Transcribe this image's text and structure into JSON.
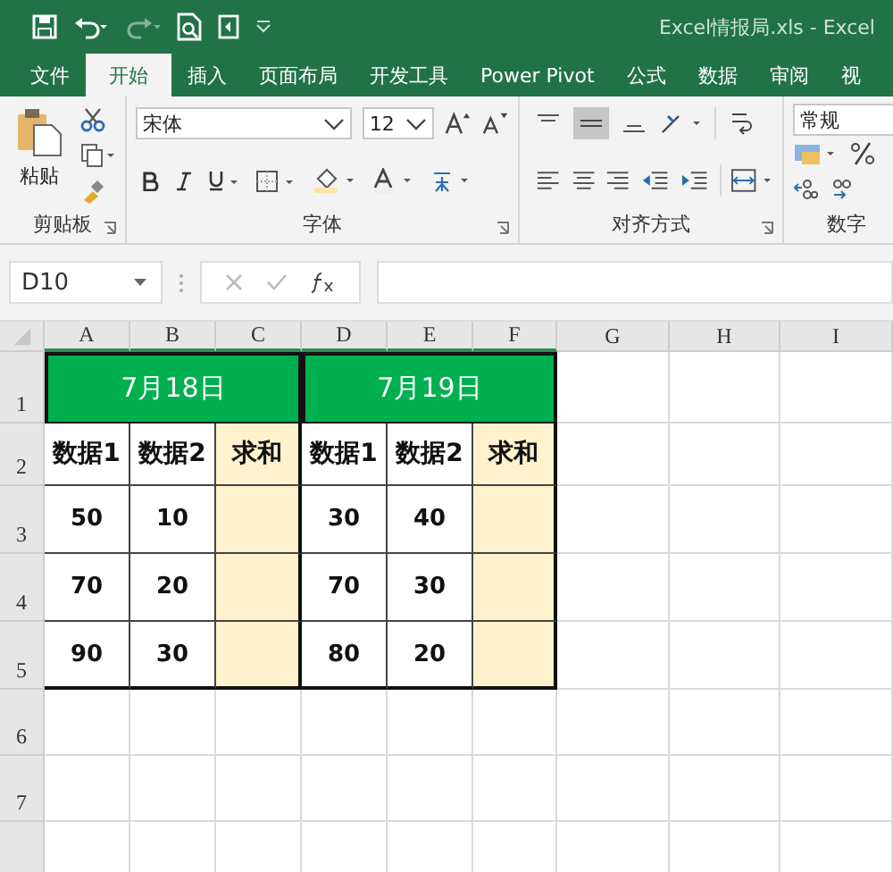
{
  "window": {
    "title": "Excel情报局.xls  -  Excel"
  },
  "tabs": [
    {
      "label": "文件",
      "selected": false
    },
    {
      "label": "开始",
      "selected": true
    },
    {
      "label": "插入",
      "selected": false
    },
    {
      "label": "页面布局",
      "selected": false
    },
    {
      "label": "开发工具",
      "selected": false
    },
    {
      "label": "Power Pivot",
      "selected": false
    },
    {
      "label": "公式",
      "selected": false
    },
    {
      "label": "数据",
      "selected": false
    },
    {
      "label": "审阅",
      "selected": false
    },
    {
      "label": "视",
      "selected": false
    }
  ],
  "ribbon": {
    "clipboard": {
      "label": "剪贴板",
      "paste": "粘贴"
    },
    "font": {
      "label": "字体",
      "font_name": "宋体",
      "font_size": "12"
    },
    "alignment": {
      "label": "对齐方式"
    },
    "number": {
      "label": "数字",
      "format": "常规"
    }
  },
  "formula_bar": {
    "name_box": "D10"
  },
  "sheet": {
    "columns": [
      "A",
      "B",
      "C",
      "D",
      "E",
      "F",
      "G",
      "H",
      "I"
    ],
    "rows": [
      "1",
      "2",
      "3",
      "4",
      "5",
      "6",
      "7"
    ],
    "tables": [
      {
        "title": "7月18日",
        "headers": [
          {
            "text": "数据1",
            "highlighted": false
          },
          {
            "text": "数据2",
            "highlighted": false
          },
          {
            "text": "求和",
            "highlighted": true
          }
        ],
        "rows": [
          [
            "50",
            "10",
            ""
          ],
          [
            "70",
            "20",
            ""
          ],
          [
            "90",
            "30",
            ""
          ]
        ]
      },
      {
        "title": "7月19日",
        "headers": [
          {
            "text": "数据1",
            "highlighted": false
          },
          {
            "text": "数据2",
            "highlighted": false
          },
          {
            "text": "求和",
            "highlighted": true
          }
        ],
        "rows": [
          [
            "30",
            "40",
            ""
          ],
          [
            "70",
            "30",
            ""
          ],
          [
            "80",
            "20",
            ""
          ]
        ]
      }
    ]
  }
}
